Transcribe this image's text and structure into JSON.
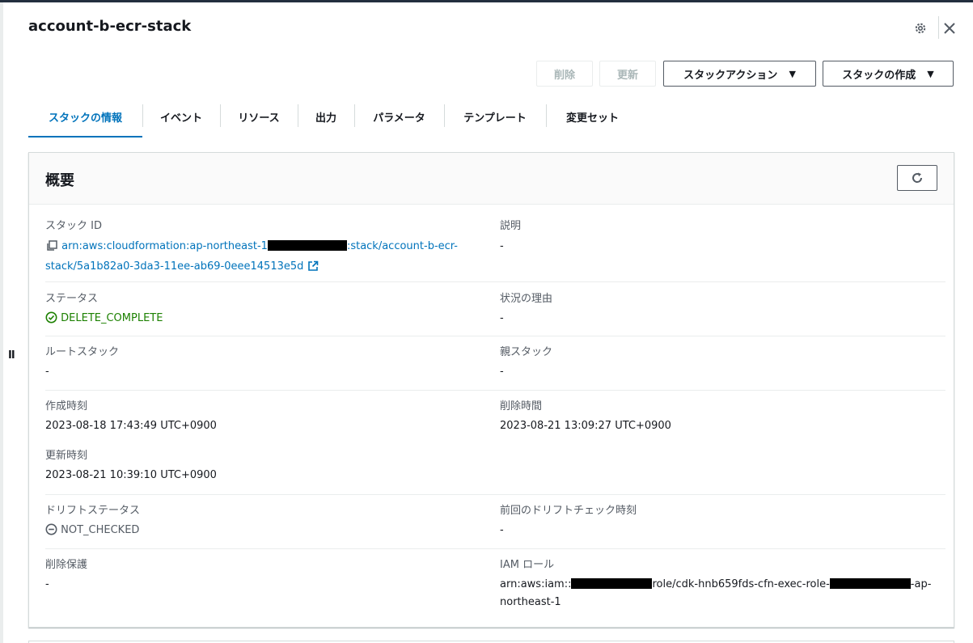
{
  "header": {
    "title": "account-b-ecr-stack",
    "icons": {
      "settings": "gear-icon",
      "close": "close-icon"
    }
  },
  "actions": {
    "delete_label": "削除",
    "update_label": "更新",
    "stack_actions_label": "スタックアクション",
    "create_stack_label": "スタックの作成"
  },
  "tabs": [
    {
      "label": "スタックの情報",
      "active": true
    },
    {
      "label": "イベント"
    },
    {
      "label": "リソース"
    },
    {
      "label": "出力"
    },
    {
      "label": "パラメータ"
    },
    {
      "label": "テンプレート"
    },
    {
      "label": "変更セット"
    }
  ],
  "overview": {
    "title": "概要",
    "stack_id_label": "スタック ID",
    "stack_id_part1": "arn:aws:cloudformation:ap-northeast-1",
    "stack_id_part2": ":stack/account-b-ecr-",
    "stack_id_part3": "stack/5a1b82a0-3da3-11ee-ab69-0eee14513e5d",
    "description_label": "説明",
    "description_value": "-",
    "status_label": "ステータス",
    "status_value": "DELETE_COMPLETE",
    "status_reason_label": "状況の理由",
    "status_reason_value": "-",
    "root_stack_label": "ルートスタック",
    "root_stack_value": "-",
    "parent_stack_label": "親スタック",
    "parent_stack_value": "-",
    "created_label": "作成時刻",
    "created_value": "2023-08-18 17:43:49 UTC+0900",
    "deleted_label": "削除時間",
    "deleted_value": "2023-08-21 13:09:27 UTC+0900",
    "updated_label": "更新時刻",
    "updated_value": "2023-08-21 10:39:10 UTC+0900",
    "drift_status_label": "ドリフトステータス",
    "drift_status_value": "NOT_CHECKED",
    "last_drift_label": "前回のドリフトチェック時刻",
    "last_drift_value": "-",
    "termination_protection_label": "削除保護",
    "termination_protection_value": "-",
    "iam_role_label": "IAM ロール",
    "iam_role_part1": "arn:aws:iam::",
    "iam_role_part2": "role/cdk-hnb659fds-cfn-exec-role-",
    "iam_role_part3": "-ap-",
    "iam_role_part4": "northeast-1"
  },
  "colors": {
    "link": "#0073bb",
    "success": "#1d8102",
    "border": "#d5dbdb"
  }
}
